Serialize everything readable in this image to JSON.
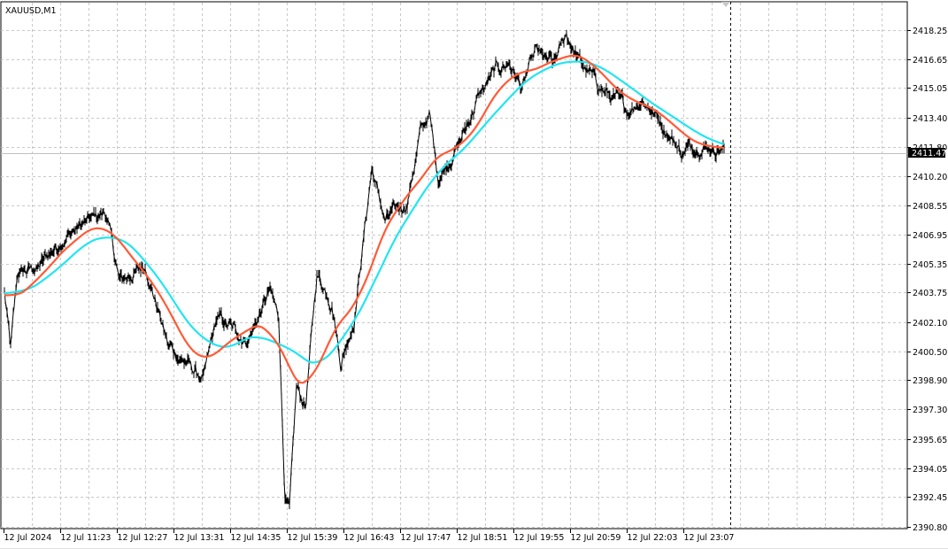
{
  "chart_data": {
    "type": "line",
    "title": "XAUUSD,M1",
    "symbol": "XAUUSD",
    "timeframe": "M1",
    "current_price": "2411.47",
    "ylim": [
      2390.8,
      2418.25
    ],
    "grid": true,
    "y_ticks": [
      "2418.25",
      "2416.65",
      "2415.05",
      "2413.40",
      "2411.80",
      "2410.20",
      "2408.55",
      "2406.95",
      "2405.35",
      "2403.75",
      "2402.10",
      "2400.50",
      "2398.90",
      "2397.30",
      "2395.65",
      "2394.05",
      "2392.45",
      "2390.80"
    ],
    "x_ticks": [
      {
        "minute": 0,
        "label": "12 Jul 2024"
      },
      {
        "minute": 64,
        "label": "12 Jul 11:23"
      },
      {
        "minute": 128,
        "label": "12 Jul 12:27"
      },
      {
        "minute": 192,
        "label": "12 Jul 13:31"
      },
      {
        "minute": 256,
        "label": "12 Jul 14:35"
      },
      {
        "minute": 320,
        "label": "12 Jul 15:39"
      },
      {
        "minute": 384,
        "label": "12 Jul 16:43"
      },
      {
        "minute": 448,
        "label": "12 Jul 17:47"
      },
      {
        "minute": 512,
        "label": "12 Jul 18:51"
      },
      {
        "minute": 576,
        "label": "12 Jul 19:55"
      },
      {
        "minute": 640,
        "label": "12 Jul 20:59"
      },
      {
        "minute": 704,
        "label": "12 Jul 22:03"
      },
      {
        "minute": 768,
        "label": "12 Jul 23:07"
      }
    ],
    "series": [
      {
        "name": "XAUUSD price",
        "color": "#000000",
        "points": [
          [
            1,
            2403.77
          ],
          [
            8,
            2400.6
          ],
          [
            16,
            2404.75
          ],
          [
            41,
            2405.2
          ],
          [
            66,
            2406.7
          ],
          [
            86,
            2407.4
          ],
          [
            116,
            2408.2
          ],
          [
            131,
            2404.3
          ],
          [
            161,
            2405.2
          ],
          [
            186,
            2400.8
          ],
          [
            226,
            2398.9
          ],
          [
            241,
            2402.3
          ],
          [
            276,
            2401.1
          ],
          [
            301,
            2403.8
          ],
          [
            311,
            2402.3
          ],
          [
            318,
            2392.5
          ],
          [
            323,
            2391.6
          ],
          [
            331,
            2398.4
          ],
          [
            341,
            2397.4
          ],
          [
            354,
            2404.75
          ],
          [
            371,
            2403.3
          ],
          [
            381,
            2399.9
          ],
          [
            396,
            2402.3
          ],
          [
            416,
            2410.6
          ],
          [
            431,
            2407.7
          ],
          [
            456,
            2408.7
          ],
          [
            471,
            2412.6
          ],
          [
            481,
            2413.6
          ],
          [
            491,
            2410.1
          ],
          [
            516,
            2412.1
          ],
          [
            536,
            2414.5
          ],
          [
            556,
            2416.0
          ],
          [
            571,
            2416.5
          ],
          [
            586,
            2415.0
          ],
          [
            601,
            2417.0
          ],
          [
            621,
            2416.25
          ],
          [
            636,
            2418.05
          ],
          [
            651,
            2416.5
          ],
          [
            676,
            2415.0
          ],
          [
            706,
            2413.8
          ],
          [
            721,
            2414.5
          ],
          [
            741,
            2413.3
          ],
          [
            766,
            2411.5
          ],
          [
            786,
            2412.0
          ],
          [
            814,
            2411.6
          ]
        ]
      },
      {
        "name": "Moving average fast",
        "color": "#ff5a36",
        "period": 22
      },
      {
        "name": "Moving average slow",
        "color": "#22e5f0",
        "period": 34
      }
    ]
  }
}
